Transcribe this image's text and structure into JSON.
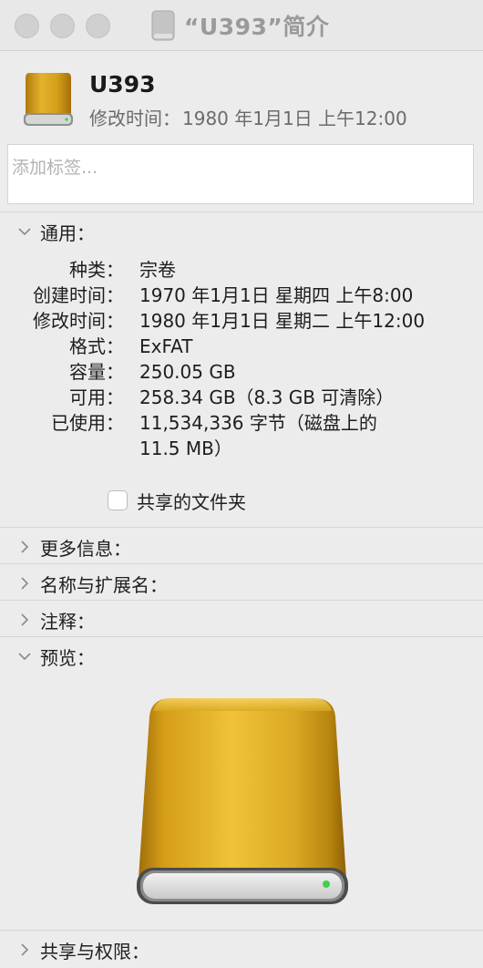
{
  "window": {
    "title": "“U393”简介"
  },
  "header": {
    "volume_name": "U393",
    "modified_label": "修改时间：",
    "modified_value": "1980 年1月1日 上午12:00"
  },
  "tags": {
    "placeholder": "添加标签..."
  },
  "sections": {
    "general": {
      "label": "通用：",
      "expanded": true
    },
    "more_info": {
      "label": "更多信息：",
      "expanded": false
    },
    "name_ext": {
      "label": "名称与扩展名：",
      "expanded": false
    },
    "comments": {
      "label": "注释：",
      "expanded": false
    },
    "preview": {
      "label": "预览：",
      "expanded": true
    },
    "sharing": {
      "label": "共享与权限：",
      "expanded": false
    }
  },
  "general": {
    "kind_label": "种类：",
    "kind_value": "宗卷",
    "created_label": "创建时间：",
    "created_value": "1970 年1月1日 星期四 上午8:00",
    "modified_label": "修改时间：",
    "modified_value": "1980 年1月1日 星期二 上午12:00",
    "format_label": "格式：",
    "format_value": "ExFAT",
    "capacity_label": "容量：",
    "capacity_value": "250.05 GB",
    "available_label": "可用：",
    "available_value": "258.34 GB（8.3 GB 可清除）",
    "used_label": "已使用：",
    "used_value_line1": "11,534,336 字节（磁盘上的",
    "used_value_line2": "11.5 MB）",
    "shared_folder_label": "共享的文件夹",
    "shared_folder_checked": false
  },
  "colors": {
    "drive_gold": "#d9a21c",
    "drive_dark_gold": "#a8760c",
    "led_green": "#3fd14a"
  }
}
